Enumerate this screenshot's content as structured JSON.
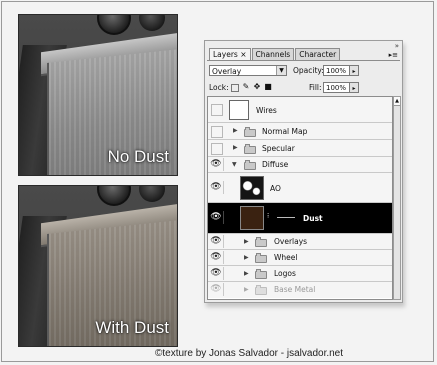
{
  "photos": {
    "no_dust_caption": "No Dust",
    "with_dust_caption": "With Dust"
  },
  "panel": {
    "tabs": [
      {
        "label": "Layers ×",
        "active": true
      },
      {
        "label": "Channels",
        "active": false
      },
      {
        "label": "Character",
        "active": false
      }
    ],
    "blend_mode": "Overlay",
    "opacity_label": "Opacity:",
    "opacity_value": "100%",
    "lock_label": "Lock:",
    "fill_label": "Fill:",
    "fill_value": "100%",
    "layers": [
      {
        "name": "Wires",
        "visible": false,
        "type": "layer"
      },
      {
        "name": "Normal Map",
        "visible": false,
        "type": "group",
        "expanded": false
      },
      {
        "name": "Specular",
        "visible": false,
        "type": "group",
        "expanded": false
      },
      {
        "name": "Diffuse",
        "visible": true,
        "type": "group",
        "expanded": true
      },
      {
        "name": "AO",
        "visible": true,
        "type": "layer"
      },
      {
        "name": "Dust",
        "visible": true,
        "type": "layer",
        "selected": true
      },
      {
        "name": "Overlays",
        "visible": true,
        "type": "group",
        "expanded": false
      },
      {
        "name": "Wheel",
        "visible": true,
        "type": "group",
        "expanded": false
      },
      {
        "name": "Logos",
        "visible": true,
        "type": "group",
        "expanded": false
      },
      {
        "name": "Base Metal",
        "visible": true,
        "type": "group",
        "expanded": false,
        "dimmed": true
      }
    ]
  },
  "credit": "©texture by Jonas Salvador - jsalvador.net",
  "colors": {
    "selection": "#000000",
    "dust_thumb": "#3a2211"
  },
  "icons": [
    "eye-icon",
    "folder-icon",
    "triangle-right-icon",
    "triangle-down-icon",
    "lock-icon",
    "brush-icon",
    "move-icon",
    "chain-link-icon"
  ]
}
